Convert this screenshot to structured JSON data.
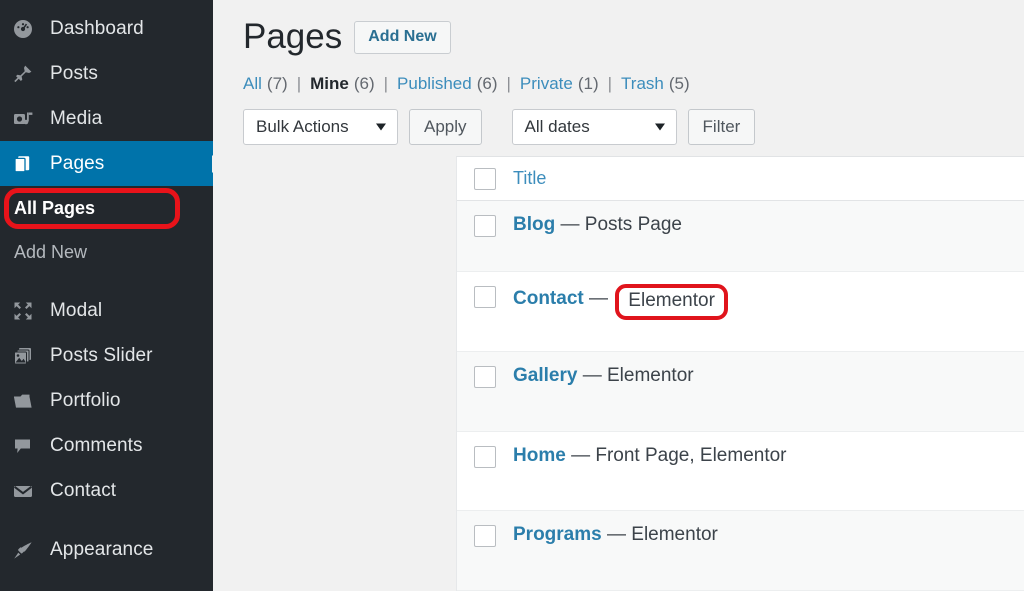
{
  "sidebar": {
    "items": [
      {
        "label": "Dashboard",
        "icon": "dashboard-gauge-icon",
        "state": "normal"
      },
      {
        "label": "Posts",
        "icon": "pin-icon",
        "state": "normal"
      },
      {
        "label": "Media",
        "icon": "media-camera-icon",
        "state": "normal"
      },
      {
        "label": "Pages",
        "icon": "pages-stack-icon",
        "state": "current"
      },
      {
        "label": "Modal",
        "icon": "expand-arrows-icon",
        "state": "normal"
      },
      {
        "label": "Posts Slider",
        "icon": "images-stack-icon",
        "state": "normal"
      },
      {
        "label": "Portfolio",
        "icon": "folder-icon",
        "state": "normal"
      },
      {
        "label": "Comments",
        "icon": "comment-bubble-icon",
        "state": "normal"
      },
      {
        "label": "Contact",
        "icon": "envelope-icon",
        "state": "normal"
      },
      {
        "label": "Appearance",
        "icon": "paintbrush-icon",
        "state": "normal"
      }
    ],
    "submenu": [
      {
        "label": "All Pages",
        "active": true,
        "highlighted": true
      },
      {
        "label": "Add New",
        "active": false,
        "highlighted": false
      }
    ],
    "colors": {
      "background": "#23282d",
      "current_item": "#0073aa",
      "annotation_red": "#e8131a"
    }
  },
  "header": {
    "title": "Pages",
    "add_new_label": "Add New"
  },
  "filter_links": [
    {
      "label": "All",
      "count": "(7)",
      "current": false
    },
    {
      "label": "Mine",
      "count": "(6)",
      "current": true
    },
    {
      "label": "Published",
      "count": "(6)",
      "current": false
    },
    {
      "label": "Private",
      "count": "(1)",
      "current": false
    },
    {
      "label": "Trash",
      "count": "(5)",
      "current": false
    }
  ],
  "filter_separator": "|",
  "toolbar": {
    "bulk_actions_value": "Bulk Actions",
    "apply_label": "Apply",
    "dates_value": "All dates",
    "filter_label": "Filter"
  },
  "table": {
    "columns": [
      "Title"
    ],
    "rows": [
      {
        "title": "Blog",
        "dash": "—",
        "meta": "Posts Page",
        "meta_highlighted": false,
        "alt": true
      },
      {
        "title": "Contact",
        "dash": "—",
        "meta": "Elementor",
        "meta_highlighted": true,
        "alt": false
      },
      {
        "title": "Gallery",
        "dash": "—",
        "meta": "Elementor",
        "meta_highlighted": false,
        "alt": true
      },
      {
        "title": "Home",
        "dash": "—",
        "meta": "Front Page, Elementor",
        "meta_highlighted": false,
        "alt": false
      },
      {
        "title": "Programs",
        "dash": "—",
        "meta": "Elementor",
        "meta_highlighted": false,
        "alt": true
      }
    ]
  }
}
